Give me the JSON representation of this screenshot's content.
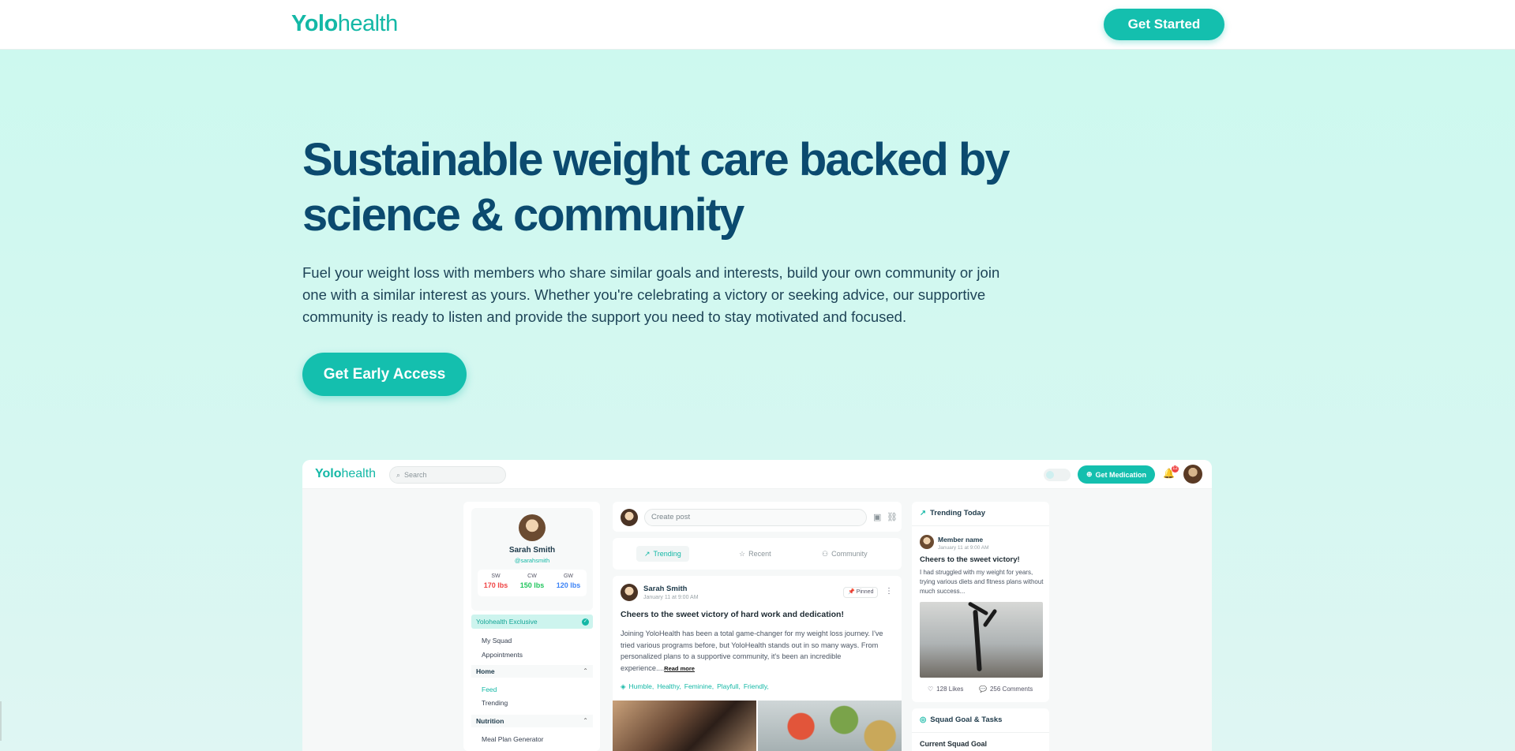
{
  "nav": {
    "brand_bold": "Yolo",
    "brand_light": "health",
    "cta": "Get Started"
  },
  "hero": {
    "headline": "Sustainable weight care backed by science & community",
    "subtext": "Fuel your weight loss with members who share similar goals and interests, build your own community or join one with a similar interest as yours. Whether you're celebrating a victory or seeking advice, our supportive community is ready to listen and provide the support you need to stay motivated and focused.",
    "cta": "Get Early Access"
  },
  "app": {
    "brand_bold": "Yolo",
    "brand_light": "health",
    "search_placeholder": "Search",
    "get_medication": "Get Medication",
    "notifications": "12",
    "profile": {
      "name": "Sarah Smith",
      "handle": "@sarahsmith",
      "stats": [
        {
          "label": "SW",
          "value": "170 lbs",
          "color": "#ef4444"
        },
        {
          "label": "CW",
          "value": "150 lbs",
          "color": "#22c55e"
        },
        {
          "label": "GW",
          "value": "120 lbs",
          "color": "#3b82f6"
        }
      ]
    },
    "sidebar": {
      "exclusive": "Yolohealth Exclusive",
      "my_squad": "My Squad",
      "appointments": "Appointments",
      "home": "Home",
      "feed": "Feed",
      "trending": "Trending",
      "nutrition": "Nutrition",
      "meal_plan": "Meal Plan Generator"
    },
    "create_post": "Create post",
    "tabs": [
      "Trending",
      "Recent",
      "Community"
    ],
    "post": {
      "author": "Sarah Smith",
      "date": "January 11 at 9:00 AM",
      "pinned": "Pinned",
      "title": "Cheers to the sweet victory of hard work and dedication!",
      "body": "Joining YoloHealth has been a total game-changer for my weight loss journey. I've tried various programs before, but YoloHealth stands out in so many ways. From personalized plans to a supportive community, it's been an incredible experience....",
      "read_more": "Read more",
      "tags": [
        "Humble,",
        "Healthy,",
        "Feminine,",
        "Playfull,",
        "Friendly,"
      ]
    },
    "trending": {
      "heading": "Trending Today",
      "member": "Member name",
      "date": "January 11 at 9:00 AM",
      "title": "Cheers to the sweet victory!",
      "body": "I had struggled with my weight for years, trying various diets and fitness plans without much success...",
      "likes": "128 Likes",
      "comments": "256 Comments"
    },
    "squad": {
      "heading": "Squad Goal & Tasks",
      "sub": "Current Squad Goal"
    }
  },
  "colors": {
    "accent": "#14bfae",
    "navy": "#0b4a6f",
    "hero_bg": "#cdf7ef"
  }
}
